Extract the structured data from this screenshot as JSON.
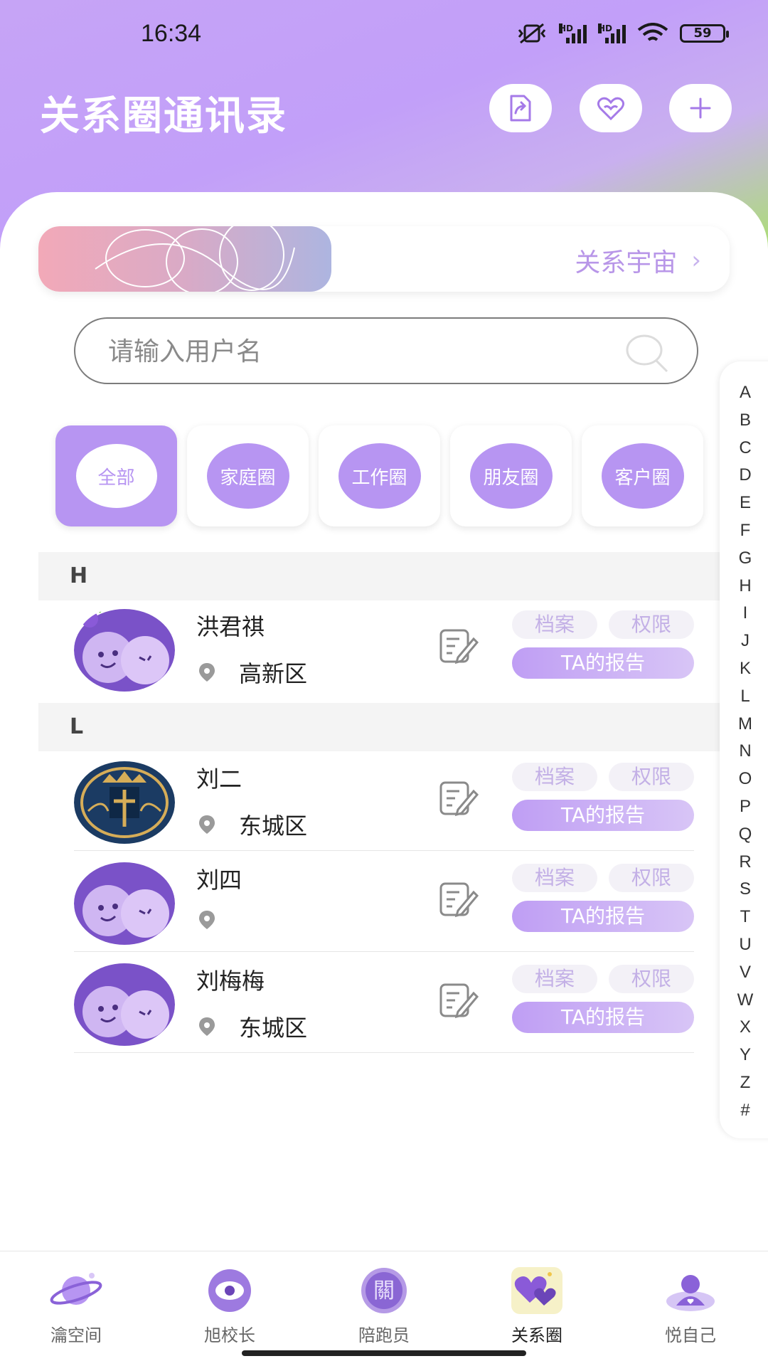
{
  "status_bar": {
    "time": "16:34",
    "battery": "59"
  },
  "header": {
    "title": "关系圈通讯录",
    "share_icon": "share-document-icon",
    "heart_icon": "double-heart-icon",
    "add_icon": "plus-icon"
  },
  "universe": {
    "label": "关系宇宙"
  },
  "search": {
    "placeholder": "请输入用户名"
  },
  "categories": [
    "全部",
    "家庭圈",
    "工作圈",
    "朋友圈",
    "客户圈"
  ],
  "sections": [
    {
      "letter": "H",
      "contacts": [
        {
          "name": "洪君祺",
          "location": "高新区"
        }
      ]
    },
    {
      "letter": "L",
      "contacts": [
        {
          "name": "刘二",
          "location": "东城区"
        },
        {
          "name": "刘四",
          "location": ""
        },
        {
          "name": "刘梅梅",
          "location": "东城区"
        }
      ]
    }
  ],
  "row_actions": {
    "doc": "档案",
    "perm": "权限",
    "report": "TA的报告"
  },
  "alphabet": [
    "A",
    "B",
    "C",
    "D",
    "E",
    "F",
    "G",
    "H",
    "I",
    "J",
    "K",
    "L",
    "M",
    "N",
    "O",
    "P",
    "Q",
    "R",
    "S",
    "T",
    "U",
    "V",
    "W",
    "X",
    "Y",
    "Z",
    "#"
  ],
  "tabs": [
    {
      "label": "瀹空间",
      "icon": "planet-icon"
    },
    {
      "label": "旭校长",
      "icon": "eye-badge-icon"
    },
    {
      "label": "陪跑员",
      "icon": "guan-badge-icon"
    },
    {
      "label": "关系圈",
      "icon": "hearts-icon"
    },
    {
      "label": "悦自己",
      "icon": "person-icon"
    }
  ],
  "colors": {
    "accent": "#b795f2",
    "tag_text": "#c3b0e6"
  }
}
